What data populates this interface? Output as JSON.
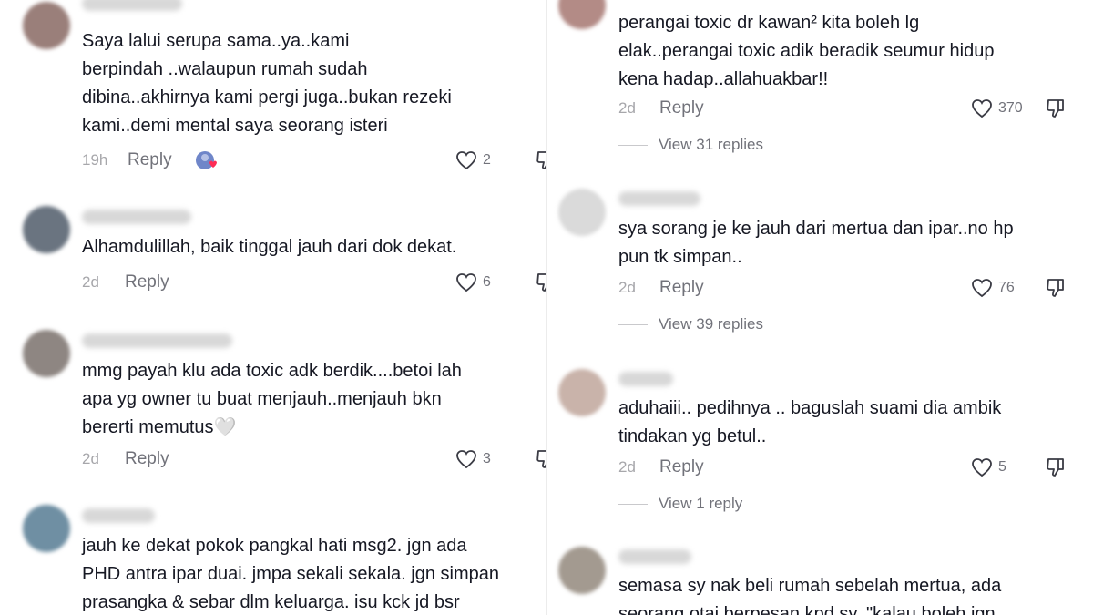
{
  "left": {
    "comments": [
      {
        "text": "Saya lalui serupa sama..ya..kami\nberpindah ..walaupun rumah sudah\ndibina..akhirnya kami pergi juga..bukan rezeki\nkami..demi mental saya seorang isteri",
        "time": "19h",
        "reply": "Reply",
        "likes": "2",
        "avatar_color": "#9a7f7a"
      },
      {
        "text": "Alhamdulillah, baik tinggal jauh dari dok dekat.",
        "time": "2d",
        "reply": "Reply",
        "likes": "6",
        "avatar_color": "#6a7480"
      },
      {
        "text": "mmg payah klu ada toxic adk berdik....betoi lah\napa yg owner tu buat menjauh..menjauh bkn\nbererti memutus🤍",
        "time": "2d",
        "reply": "Reply",
        "likes": "3",
        "avatar_color": "#8e8682"
      },
      {
        "text": "jauh ke dekat pokok pangkal hati msg2. jgn ada\nPHD antra ipar duai. jmpa sekali sekala. jgn simpan\nprasangka & sebar dlm keluarga. isu kck jd bsr",
        "avatar_color": "#6f8fa3"
      }
    ]
  },
  "right": {
    "comments": [
      {
        "text": "perangai toxic dr kawan² kita boleh lg\nelak..perangai toxic adik beradik seumur hidup\nkena hadap..allahuakbar!!",
        "time": "2d",
        "reply": "Reply",
        "likes": "370",
        "view_replies": "View 31 replies",
        "avatar_color": "#b38b86"
      },
      {
        "text": "sya sorang je ke jauh dari mertua dan ipar..no hp\npun tk simpan..",
        "time": "2d",
        "reply": "Reply",
        "likes": "76",
        "view_replies": "View 39 replies",
        "avatar_color": "#dadada"
      },
      {
        "text": "aduhaiii.. pedihnya .. baguslah suami dia ambik\ntindakan yg betul..",
        "time": "2d",
        "reply": "Reply",
        "likes": "5",
        "view_replies": "View 1 reply",
        "avatar_color": "#c9b3aa"
      },
      {
        "text": "semasa sy nak beli rumah sebelah mertua, ada\nseorang otai berpesan kpd sy, \"kalau boleh jgn",
        "avatar_color": "#a39a90"
      }
    ]
  },
  "icons": {
    "like": "heart-outline-icon",
    "dislike": "thumbs-down-outline-icon",
    "creator_liked": "creator-liked-badge-icon"
  }
}
